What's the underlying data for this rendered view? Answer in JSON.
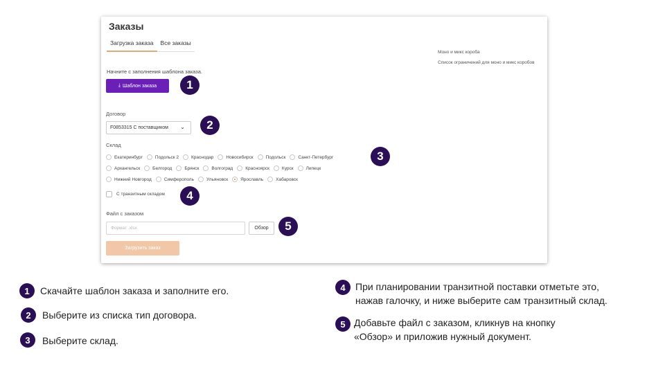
{
  "app": {
    "title": "Заказы",
    "tabs": [
      "Загрузка заказа",
      "Все заказы"
    ],
    "side_links": [
      "Моно и микс короба",
      "Список ограничений для моно и микс коробов"
    ],
    "hint": "Начните с заполнения шаблона заказа.",
    "template_button": "Шаблон заказа",
    "contract": {
      "label": "Договор",
      "value": "F0853315 С поставщиком"
    },
    "warehouse": {
      "label": "Склад",
      "rows": [
        [
          "Екатеринбург",
          "Подольск 2",
          "Краснодар",
          "Новосибирск",
          "Подольск",
          "Санкт-Петербург"
        ],
        [
          "Архангельск",
          "Белгород",
          "Брянск",
          "Волгоград",
          "Красноярск",
          "Курск",
          "Липецк"
        ],
        [
          "Нижний Новгород",
          "Симферополь",
          "Ульяновск",
          "Ярославль",
          "Хабаровск"
        ]
      ],
      "selected": "Ярославль"
    },
    "transit_label": "С транзитным складом",
    "file": {
      "label": "Файл с заказом",
      "placeholder": "Формат .xlsx",
      "browse": "Обзор"
    },
    "upload_button": "Загрузить заказ"
  },
  "badges": [
    "1",
    "2",
    "3",
    "4",
    "5"
  ],
  "notes": {
    "n1": "Скачайте шаблон заказа и заполните его.",
    "n2": "Выберите из списка тип договора.",
    "n3": "Выберите склад.",
    "n4_line1": "При планировании транзитной поставки отметьте это,",
    "n4_line2": "нажав галочку, и ниже выберите сам транзитный склад.",
    "n5_line1": "Добавьте файл с заказом, кликнув на кнопку",
    "n5_line2": "«Обзор» и приложив нужный документ."
  },
  "colors": {
    "primary": "#6a1fb8",
    "badge": "#2a0f57",
    "upload": "#f1c7a8",
    "tab_underline": "#e3a97a"
  },
  "icons": {
    "download": "download-icon",
    "chevron": "chevron-down-icon"
  }
}
